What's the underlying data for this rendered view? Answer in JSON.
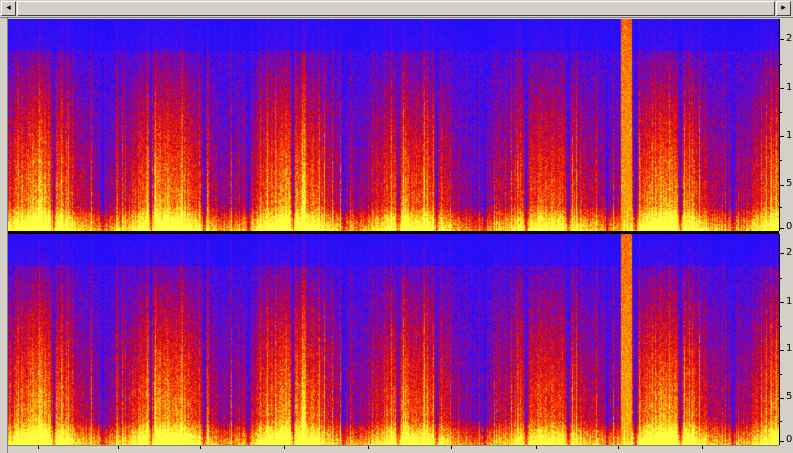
{
  "scrollbar": {
    "left_arrow": "◂",
    "right_arrow": "▸"
  },
  "spectrogram": {
    "colormap": [
      "#1a10ff",
      "#6a0ad8",
      "#c8001e",
      "#ff2a00",
      "#ffb000",
      "#ffff40"
    ],
    "background": "#1818ff"
  },
  "frequency_ruler": {
    "top_labels": [
      "2",
      "1",
      "1",
      "5",
      "0"
    ],
    "bottom_labels": [
      "2",
      "1",
      "1",
      "5",
      "0"
    ]
  }
}
